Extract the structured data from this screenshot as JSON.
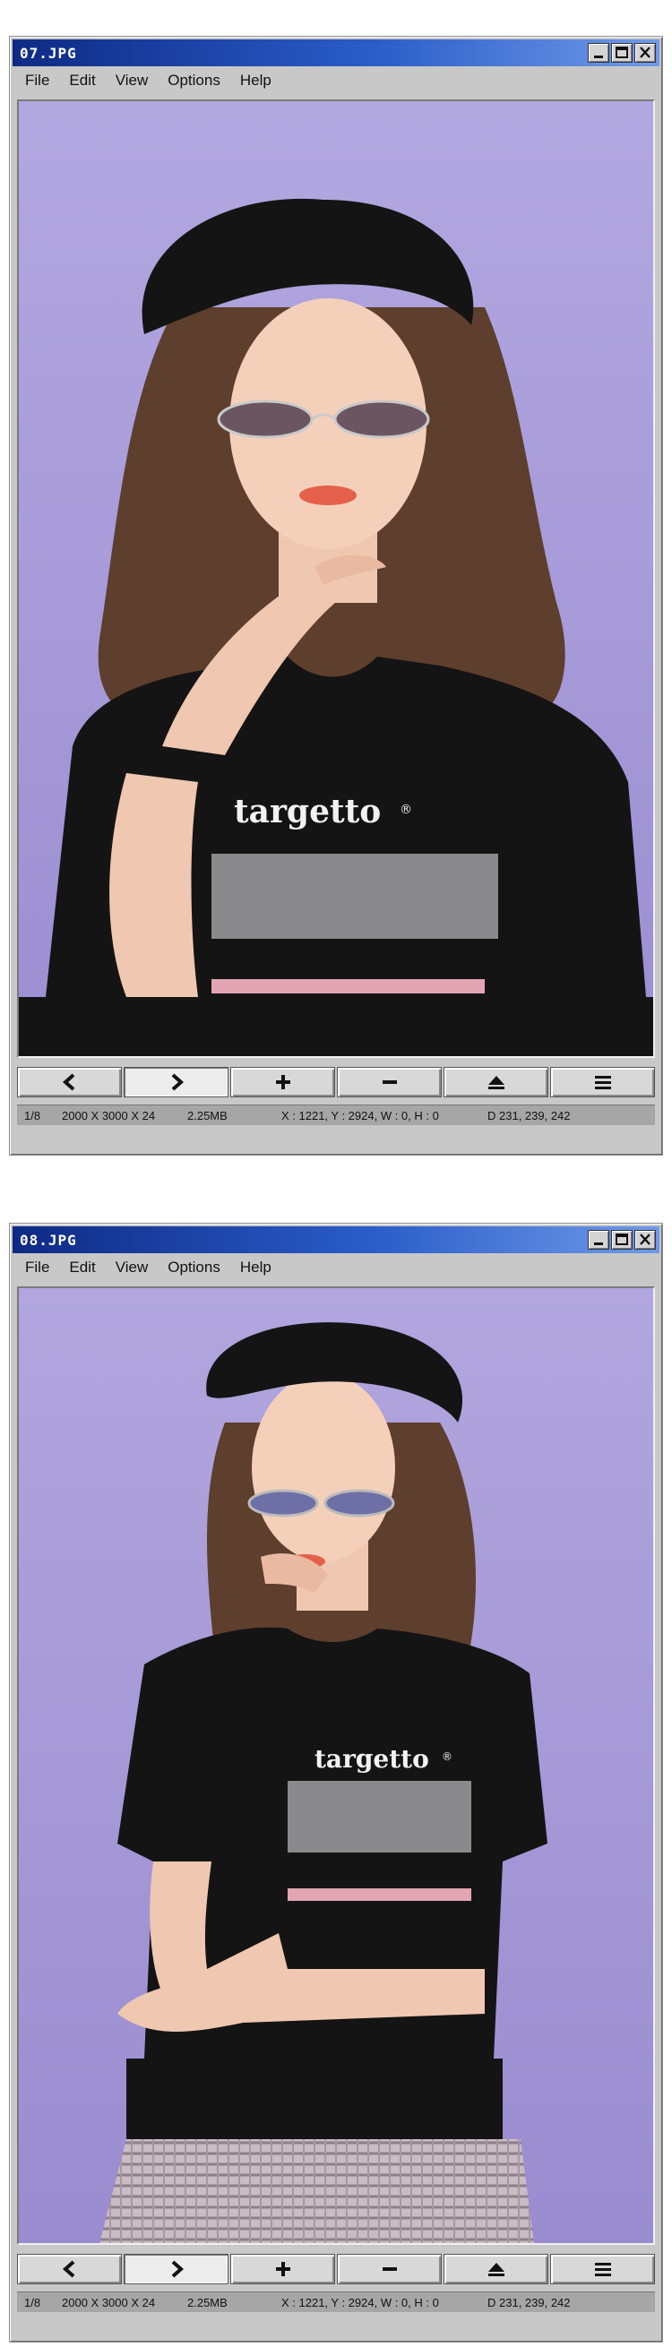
{
  "windows": [
    {
      "title": "07.JPG",
      "menu": [
        "File",
        "Edit",
        "View",
        "Options",
        "Help"
      ],
      "photo": {
        "logo_text": "targetto",
        "logo_mark": "®"
      },
      "toolbar": [
        "prev-arrow-icon",
        "next-arrow-icon",
        "zoom-in-icon",
        "zoom-out-icon",
        "eject-icon",
        "menu-icon"
      ],
      "status": {
        "index": "1/8",
        "dimensions": "2000 X 3000 X 24",
        "size": "2.25MB",
        "coords": "X : 1221, Y : 2924, W : 0, H : 0",
        "color": "D 231, 239, 242"
      }
    },
    {
      "title": "08.JPG",
      "menu": [
        "File",
        "Edit",
        "View",
        "Options",
        "Help"
      ],
      "photo": {
        "logo_text": "targetto",
        "logo_mark": "®"
      },
      "toolbar": [
        "prev-arrow-icon",
        "next-arrow-icon",
        "zoom-in-icon",
        "zoom-out-icon",
        "eject-icon",
        "menu-icon"
      ],
      "status": {
        "index": "1/8",
        "dimensions": "2000 X 3000 X 24",
        "size": "2.25MB",
        "coords": "X : 1221, Y : 2924, W : 0, H : 0",
        "color": "D 231, 239, 242"
      }
    }
  ],
  "colors": {
    "titlebar_start": "#0e2a84",
    "titlebar_end": "#6f9ae8",
    "window_gray": "#c8c8c8",
    "backdrop_lavender": "#a79ad6",
    "shirt_black": "#141414",
    "stripe_gray": "#8a8a8c",
    "stripe_pink": "#e3a5b3"
  }
}
